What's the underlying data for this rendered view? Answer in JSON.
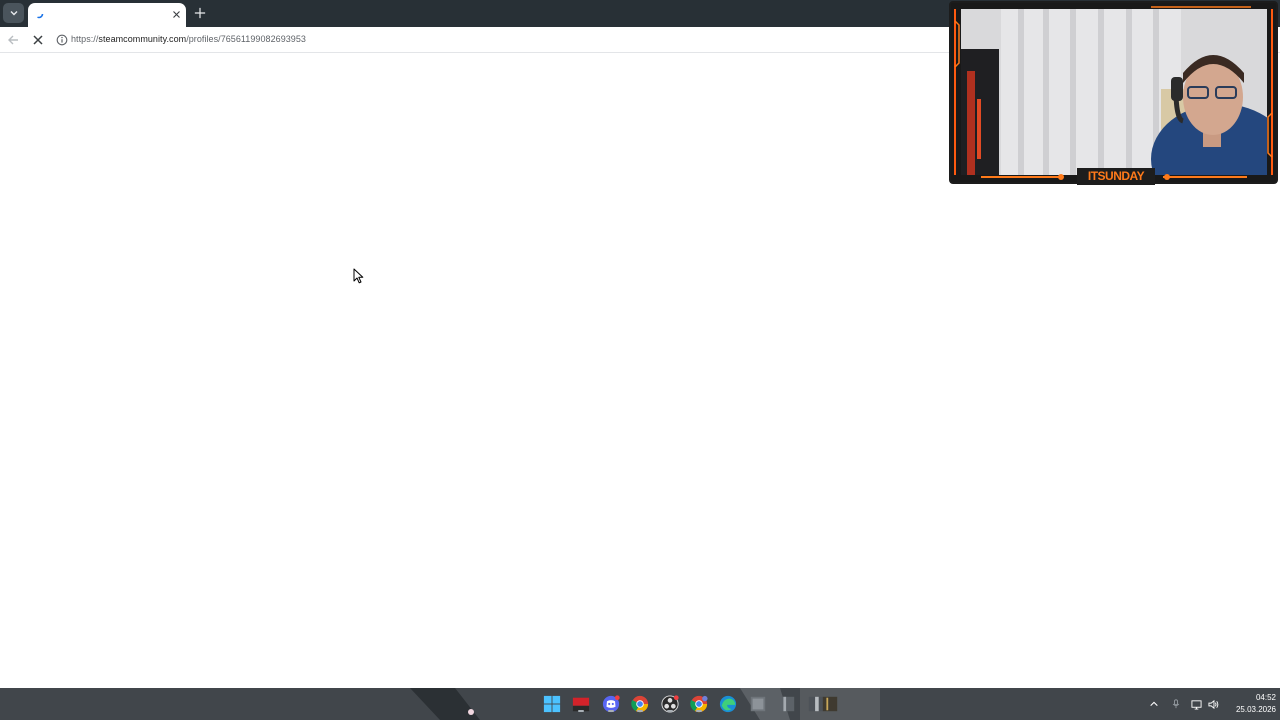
{
  "browser": {
    "tab": {
      "title": "",
      "state": "loading"
    },
    "address_bar": {
      "scheme": "https://",
      "host": "steamcommunity.com",
      "path": "/profiles/76561199082693953"
    }
  },
  "webcam": {
    "label": "ITSUNDAY",
    "accent_color": "#ff7a1a"
  },
  "taskbar": {
    "pinned_icons": [
      "windows-start",
      "app-badge",
      "discord",
      "chrome",
      "obs-studio",
      "chrome-profile",
      "edge",
      "app-window-1",
      "app-window-2",
      "app-window-3",
      "app-window-4"
    ],
    "tray_icons": [
      "chevron-up",
      "microphone",
      "network",
      "volume"
    ],
    "clock": {
      "time": "04:52",
      "date": "25.03.2026"
    }
  }
}
